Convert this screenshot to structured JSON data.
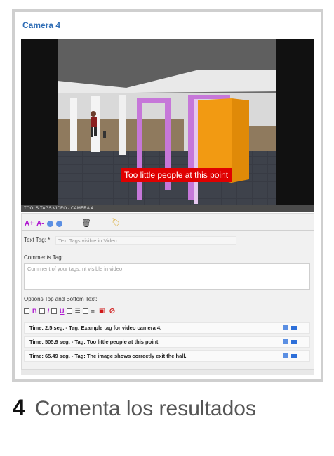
{
  "card": {
    "title": "Camera 4"
  },
  "video": {
    "overlay_text": "Too little people at this point"
  },
  "tools_bar": {
    "label": "TOOLS TAGS VIDEO - CAMERA 4"
  },
  "toolbar": {
    "font_increase": "A+",
    "font_decrease": "A-",
    "icons": [
      "play-icon",
      "pause-icon",
      "trash-icon",
      "tag-icon"
    ]
  },
  "form": {
    "text_tag_label": "Text Tag: *",
    "text_tag_placeholder": "Text Tags visible in Video",
    "comments_label": "Comments Tag:",
    "comments_placeholder": "Comment of your tags, nt visible in video",
    "options_label": "Options Top and Bottom Text:"
  },
  "format_options": {
    "bold": "B",
    "italic": "I",
    "underline": "U",
    "align_left": "☰",
    "align_center": "≡",
    "color_icon": "color-icon",
    "clear_icon": "clear-icon"
  },
  "tags": [
    {
      "text": "Time: 2.5 seg. - Tag: Example tag for video camera 4."
    },
    {
      "text": "Time: 505.9 seg. - Tag: Too little people at this point"
    },
    {
      "text": "Time: 65.49 seg. - Tag: The image shows correctly exit the hall."
    }
  ],
  "footer": {
    "step_number": "4",
    "step_text": "Comenta los resultados"
  },
  "colors": {
    "accent": "#2f6db5",
    "tool_accent": "#b01ad0",
    "overlay": "#e00000"
  }
}
